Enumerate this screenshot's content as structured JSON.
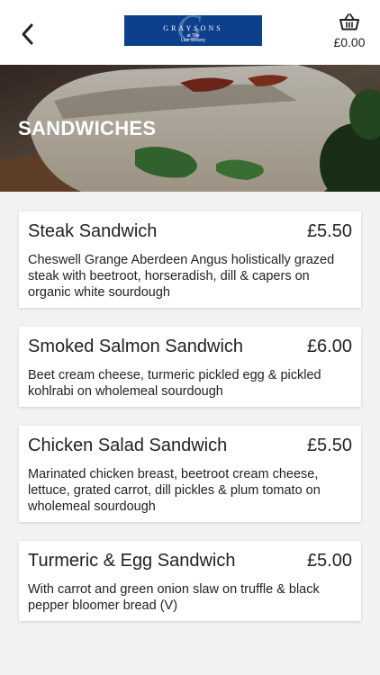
{
  "header": {
    "logo": {
      "name": "GRAYSONS",
      "line1": "at The",
      "line2": "Law Society",
      "monogram": "G"
    },
    "cart": {
      "total": "£0.00",
      "icon": "basket-icon"
    },
    "back_icon": "chevron-left-icon"
  },
  "category": {
    "title": "SANDWICHES"
  },
  "items": [
    {
      "name": "Steak Sandwich",
      "price": "£5.50",
      "description": "Cheswell Grange Aberdeen Angus holistically grazed steak with beetroot, horseradish, dill & capers on organic white sourdough"
    },
    {
      "name": "Smoked Salmon Sandwich",
      "price": "£6.00",
      "description": "Beet cream cheese, turmeric pickled egg & pickled kohlrabi on wholemeal sourdough"
    },
    {
      "name": "Chicken Salad Sandwich",
      "price": "£5.50",
      "description": "Marinated chicken breast, beetroot cream cheese, lettuce, grated carrot, dill pickles & plum tomato on wholemeal sourdough"
    },
    {
      "name": "Turmeric & Egg Sandwich",
      "price": "£5.00",
      "description": "With carrot and green onion slaw on truffle & black pepper bloomer bread (V)"
    }
  ],
  "colors": {
    "brand": "#0c3f8c",
    "background": "#f2f2f2",
    "card": "#ffffff",
    "text": "#222222"
  }
}
